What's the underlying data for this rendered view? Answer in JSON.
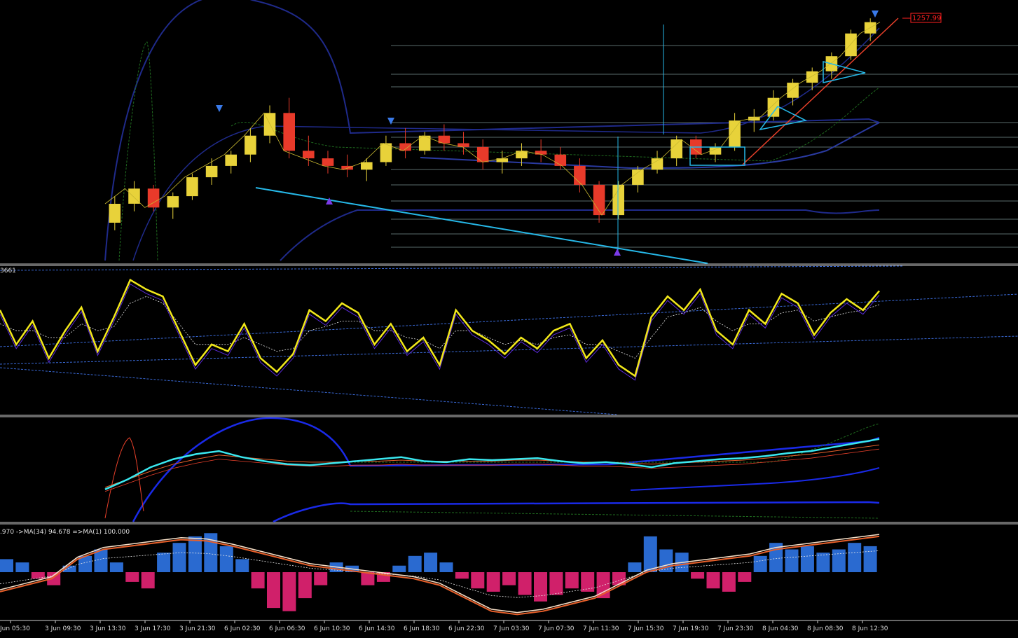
{
  "chart_data": {
    "type": "line",
    "price_label": "1257.99",
    "x_tick_labels": [
      "Jun 05:30",
      "3 Jun 09:30",
      "3 Jun 13:30",
      "3 Jun 17:30",
      "3 Jun 21:30",
      "6 Jun 02:30",
      "6 Jun 06:30",
      "6 Jun 10:30",
      "6 Jun 14:30",
      "6 Jun 18:30",
      "6 Jun 22:30",
      "7 Jun 03:30",
      "7 Jun 07:30",
      "7 Jun 11:30",
      "7 Jun 15:30",
      "7 Jun 19:30",
      "7 Jun 23:30",
      "8 Jun 04:30",
      "8 Jun 08:30",
      "8 Jun 12:30"
    ],
    "panel2_label": "3661",
    "panel4_label": ".970  ->MA(34) 94.678  =>MA(1) 100.000",
    "price_panel": {
      "candles": [
        [
          1205,
          1212,
          1203,
          1210
        ],
        [
          1210,
          1216,
          1208,
          1214
        ],
        [
          1214,
          1215,
          1208,
          1209
        ],
        [
          1209,
          1213,
          1206,
          1212
        ],
        [
          1212,
          1218,
          1211,
          1217
        ],
        [
          1217,
          1222,
          1215,
          1220
        ],
        [
          1220,
          1224,
          1218,
          1223
        ],
        [
          1223,
          1230,
          1221,
          1228
        ],
        [
          1228,
          1236,
          1226,
          1234
        ],
        [
          1234,
          1238,
          1222,
          1224
        ],
        [
          1224,
          1228,
          1220,
          1222
        ],
        [
          1222,
          1224,
          1218,
          1220
        ],
        [
          1220,
          1223,
          1217,
          1219
        ],
        [
          1219,
          1222,
          1216,
          1221
        ],
        [
          1221,
          1228,
          1220,
          1226
        ],
        [
          1226,
          1230,
          1222,
          1224
        ],
        [
          1224,
          1229,
          1223,
          1228
        ],
        [
          1228,
          1231,
          1224,
          1226
        ],
        [
          1226,
          1229,
          1223,
          1225
        ],
        [
          1225,
          1227,
          1219,
          1221
        ],
        [
          1221,
          1224,
          1218,
          1222
        ],
        [
          1222,
          1226,
          1220,
          1224
        ],
        [
          1224,
          1227,
          1221,
          1223
        ],
        [
          1223,
          1225,
          1219,
          1220
        ],
        [
          1220,
          1222,
          1213,
          1215
        ],
        [
          1215,
          1216,
          1205,
          1207
        ],
        [
          1207,
          1216,
          1206,
          1215
        ],
        [
          1215,
          1220,
          1213,
          1219
        ],
        [
          1219,
          1224,
          1218,
          1222
        ],
        [
          1222,
          1228,
          1220,
          1227
        ],
        [
          1227,
          1228,
          1222,
          1223
        ],
        [
          1223,
          1226,
          1221,
          1225
        ],
        [
          1225,
          1234,
          1224,
          1232
        ],
        [
          1232,
          1235,
          1229,
          1233
        ],
        [
          1233,
          1240,
          1232,
          1238
        ],
        [
          1238,
          1243,
          1236,
          1242
        ],
        [
          1242,
          1246,
          1240,
          1245
        ],
        [
          1245,
          1250,
          1243,
          1249
        ],
        [
          1249,
          1256,
          1248,
          1255
        ],
        [
          1255,
          1259,
          1253,
          1258
        ]
      ],
      "ylim": [
        1195,
        1262
      ]
    },
    "rsi_panel": {
      "series": [
        {
          "values": [
            70,
            45,
            62,
            35,
            55,
            72,
            40,
            65,
            92,
            85,
            80,
            55,
            30,
            45,
            40,
            60,
            35,
            25,
            38,
            70,
            62,
            75,
            68,
            45,
            60,
            40,
            50,
            30,
            70,
            55,
            48,
            38,
            50,
            42,
            55,
            60,
            35,
            48,
            30,
            22,
            65,
            80,
            70,
            85,
            55,
            45,
            70,
            60,
            82,
            75,
            52,
            68,
            78,
            70,
            84
          ]
        },
        {
          "values": [
            60,
            55,
            55,
            50,
            50,
            60,
            55,
            58,
            75,
            80,
            75,
            60,
            45,
            45,
            45,
            50,
            45,
            40,
            42,
            55,
            58,
            62,
            62,
            55,
            55,
            50,
            48,
            42,
            55,
            55,
            50,
            45,
            48,
            45,
            50,
            52,
            45,
            45,
            40,
            35,
            50,
            65,
            68,
            72,
            62,
            55,
            60,
            60,
            68,
            70,
            62,
            65,
            68,
            70,
            74
          ]
        }
      ],
      "ylim": [
        0,
        100
      ]
    },
    "ma_panel": {
      "series": [
        {
          "values": [
            30,
            40,
            52,
            60,
            65,
            68,
            62,
            58,
            55,
            54,
            56,
            58,
            60,
            62,
            58,
            57,
            60,
            59,
            60,
            61,
            58,
            56,
            57,
            55,
            52,
            56,
            58,
            60,
            61,
            63,
            66,
            68,
            72,
            76,
            80
          ]
        },
        {
          "values": [
            32,
            40,
            48,
            55,
            60,
            64,
            62,
            60,
            58,
            57,
            57,
            58,
            58,
            59,
            58,
            58,
            58,
            58,
            59,
            59,
            58,
            57,
            57,
            56,
            55,
            56,
            57,
            58,
            59,
            61,
            63,
            65,
            68,
            71,
            74
          ]
        }
      ],
      "ylim": [
        0,
        100
      ]
    },
    "histogram_panel": {
      "values": [
        20,
        15,
        -10,
        -20,
        10,
        25,
        35,
        15,
        -15,
        -25,
        30,
        45,
        55,
        60,
        40,
        20,
        -25,
        -55,
        -60,
        -40,
        -20,
        15,
        10,
        -20,
        -15,
        10,
        25,
        30,
        15,
        -10,
        -25,
        -30,
        -20,
        -35,
        -45,
        -35,
        -25,
        -30,
        -40,
        -20,
        15,
        55,
        35,
        30,
        -10,
        -25,
        -30,
        -15,
        25,
        45,
        35,
        40,
        30,
        35,
        45,
        40
      ],
      "signal": [
        -30,
        -20,
        -10,
        20,
        35,
        40,
        45,
        50,
        48,
        40,
        30,
        20,
        10,
        5,
        0,
        -5,
        -10,
        -20,
        -40,
        -60,
        -65,
        -60,
        -50,
        -40,
        -20,
        0,
        10,
        15,
        20,
        25,
        35,
        40,
        45,
        50,
        55
      ],
      "ylim": [
        -70,
        70
      ]
    }
  }
}
